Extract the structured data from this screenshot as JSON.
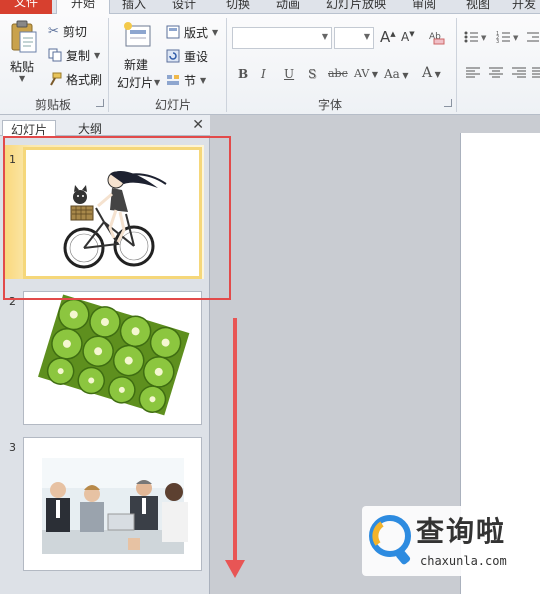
{
  "tabs": {
    "file": "文件",
    "active": "开始",
    "others": [
      "插入",
      "设计",
      "切换",
      "动画",
      "幻灯片放映",
      "审阅",
      "视图",
      "开发"
    ]
  },
  "clipboard": {
    "paste": "粘贴",
    "cut": "剪切",
    "copy": "复制",
    "format_painter": "格式刷",
    "label": "剪贴板"
  },
  "slides_group": {
    "new_slide_line1": "新建",
    "new_slide_line2": "幻灯片",
    "layout": "版式",
    "reset": "重设",
    "section": "节",
    "label": "幻灯片"
  },
  "font_group": {
    "label": "字体",
    "bold": "B",
    "italic": "I",
    "underline": "U",
    "shadow": "S",
    "strike": "abc",
    "spacing": "AV",
    "case": "Aa",
    "color": "A",
    "grow": "A",
    "shrink": "A"
  },
  "pane": {
    "tab_slides": "幻灯片",
    "tab_outline": "大纲",
    "close": "✕"
  },
  "slides": [
    {
      "number": "1"
    },
    {
      "number": "2"
    },
    {
      "number": "3"
    }
  ],
  "watermark": {
    "brand": "查询啦",
    "url": "chaxunla.com"
  },
  "colors": {
    "file_tab": "#d7402f",
    "highlight_box": "#e24a4a",
    "selection": "#f5d77a"
  }
}
